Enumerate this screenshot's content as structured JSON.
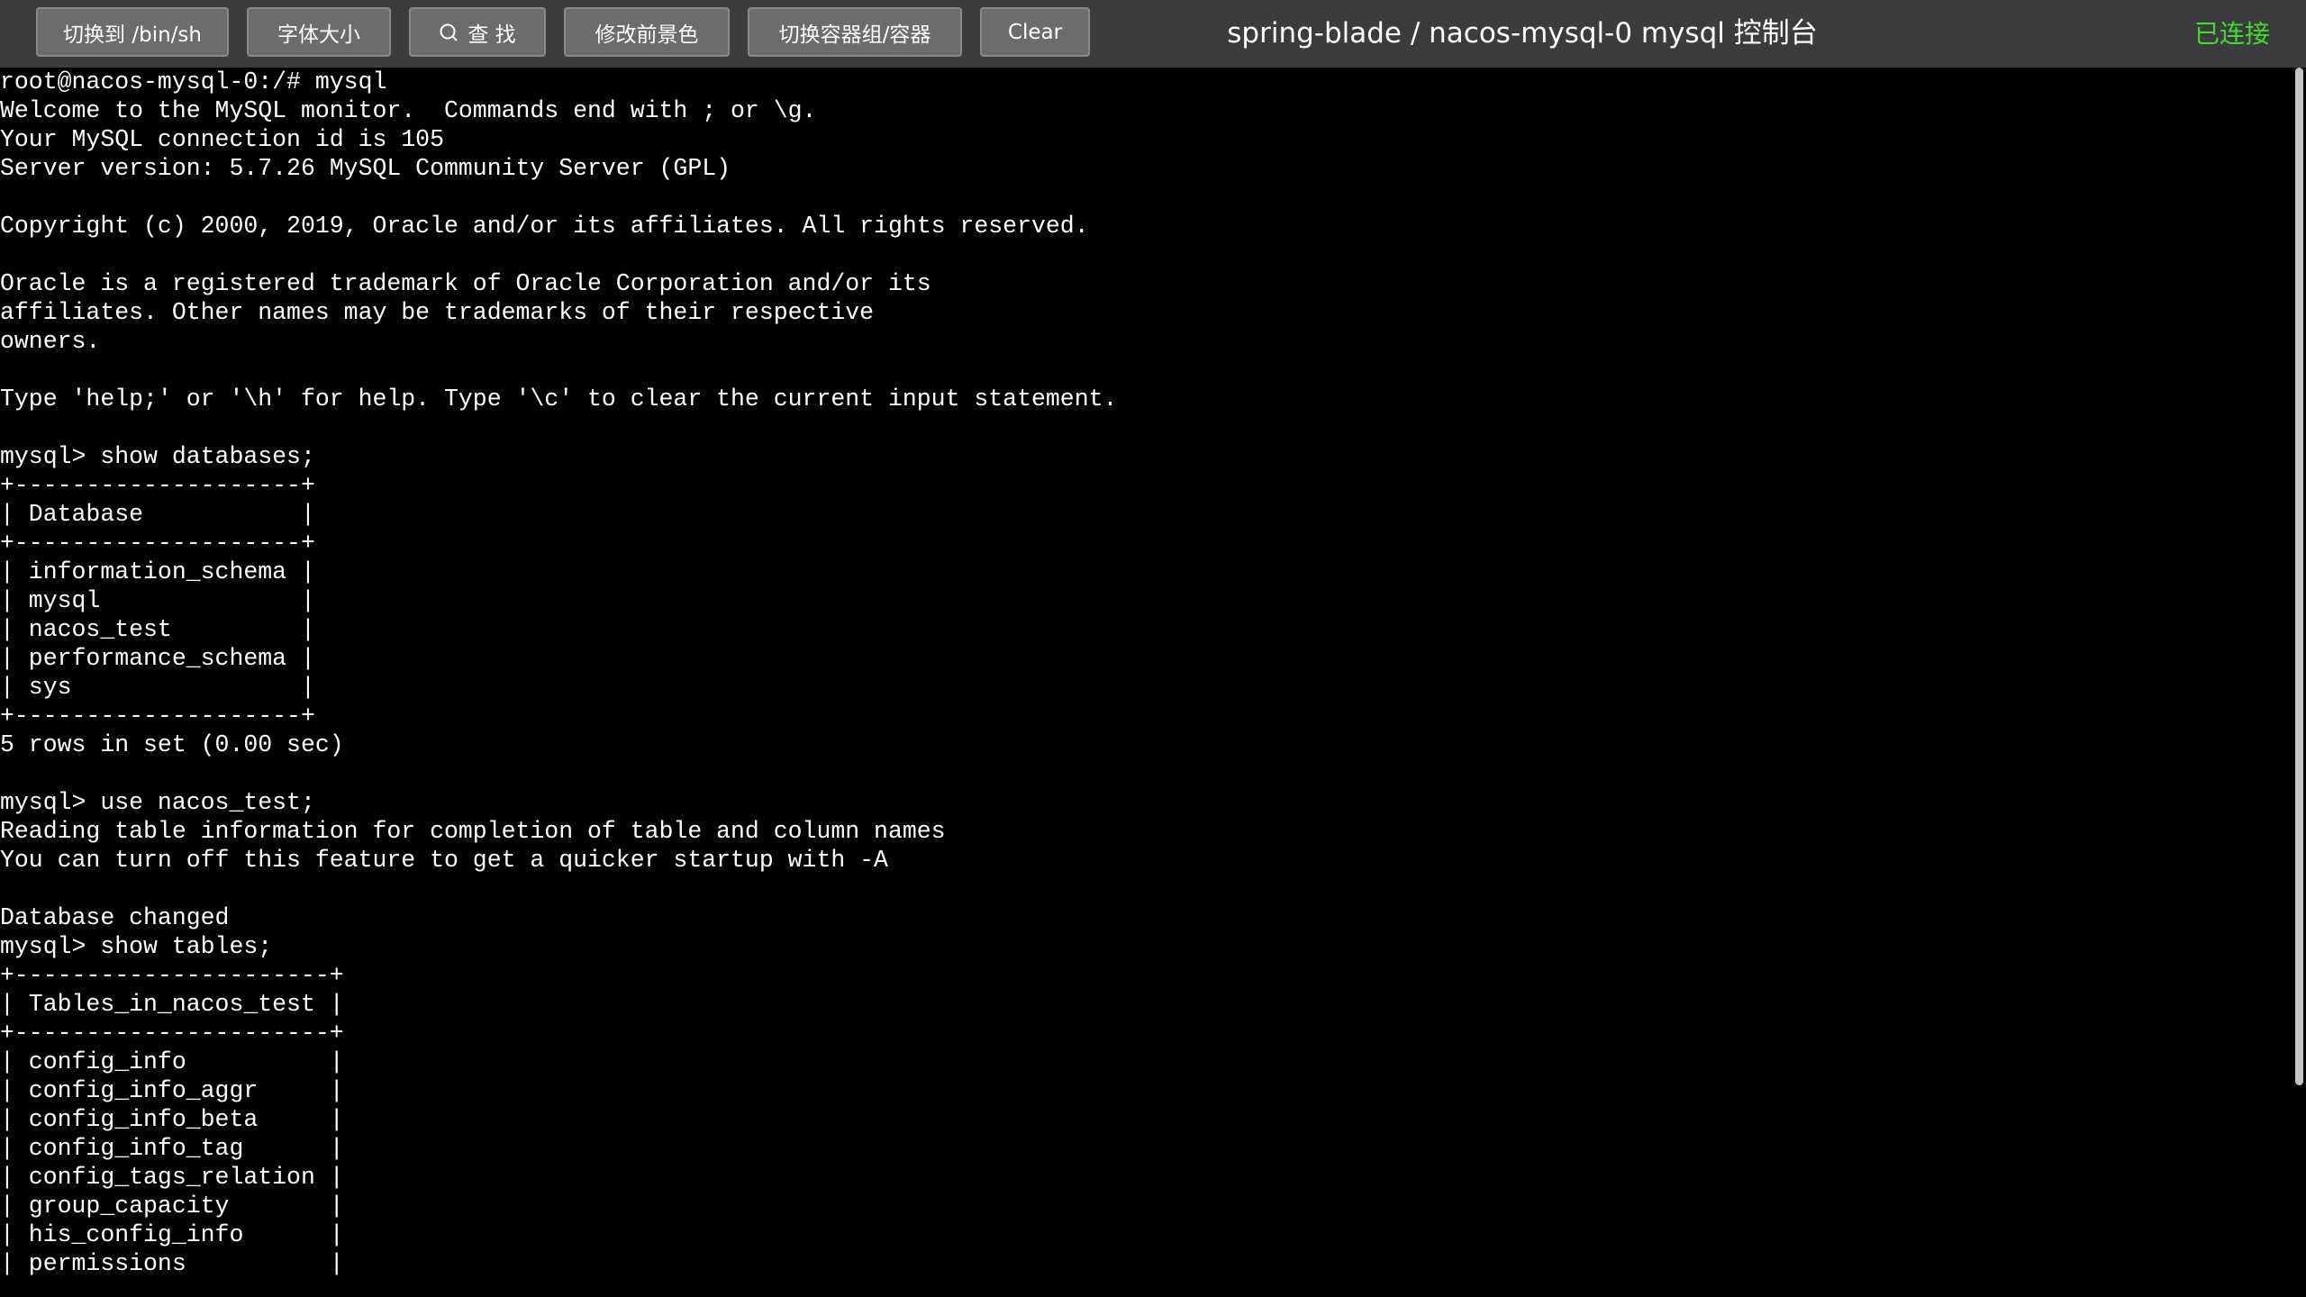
{
  "toolbar": {
    "switch_shell_label": "切换到 /bin/sh",
    "font_size_label": "字体大小",
    "find_label": "查 找",
    "foreground_label": "修改前景色",
    "switch_group_label": "切换容器组/容器",
    "clear_label": "Clear",
    "find_icon": "search-icon"
  },
  "header": {
    "title": "spring-blade / nacos-mysql-0 mysql 控制台",
    "status": "已连接",
    "status_color": "#3ddc2e"
  },
  "terminal": {
    "lines": [
      "root@nacos-mysql-0:/# mysql",
      "Welcome to the MySQL monitor.  Commands end with ; or \\g.",
      "Your MySQL connection id is 105",
      "Server version: 5.7.26 MySQL Community Server (GPL)",
      "",
      "Copyright (c) 2000, 2019, Oracle and/or its affiliates. All rights reserved.",
      "",
      "Oracle is a registered trademark of Oracle Corporation and/or its",
      "affiliates. Other names may be trademarks of their respective",
      "owners.",
      "",
      "Type 'help;' or '\\h' for help. Type '\\c' to clear the current input statement.",
      "",
      "mysql> show databases;",
      "+--------------------+",
      "| Database           |",
      "+--------------------+",
      "| information_schema |",
      "| mysql              |",
      "| nacos_test         |",
      "| performance_schema |",
      "| sys                |",
      "+--------------------+",
      "5 rows in set (0.00 sec)",
      "",
      "mysql> use nacos_test;",
      "Reading table information for completion of table and column names",
      "You can turn off this feature to get a quicker startup with -A",
      "",
      "Database changed",
      "mysql> show tables;",
      "+----------------------+",
      "| Tables_in_nacos_test |",
      "+----------------------+",
      "| config_info          |",
      "| config_info_aggr     |",
      "| config_info_beta     |",
      "| config_info_tag      |",
      "| config_tags_relation |",
      "| group_capacity       |",
      "| his_config_info      |",
      "| permissions          |"
    ]
  }
}
